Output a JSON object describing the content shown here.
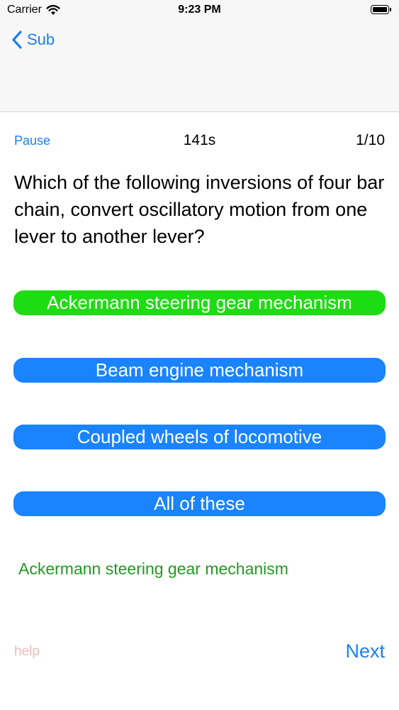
{
  "status_bar": {
    "carrier": "Carrier",
    "time": "9:23 PM"
  },
  "nav": {
    "back_label": "Sub"
  },
  "quiz": {
    "pause_label": "Pause",
    "timer": "141s",
    "progress": "1/10",
    "question": "Which of the following inversions of four bar chain, convert oscillatory motion from one lever to another lever?",
    "answers": [
      "Ackermann steering gear mechanism",
      "Beam engine mechanism",
      "Coupled wheels of locomotive",
      "All of these"
    ],
    "result": "Ackermann steering gear mechanism",
    "help_label": "help",
    "next_label": "Next"
  },
  "colors": {
    "accent": "#1a7ef5",
    "answer_default": "#1a84ff",
    "answer_correct": "#1edc12",
    "result_text": "#229a22",
    "help_text": "#f6b9b9"
  }
}
